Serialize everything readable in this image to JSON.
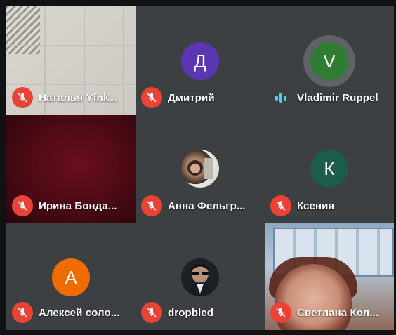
{
  "participants": [
    {
      "name": "Наталья Yfnk...",
      "muted": true,
      "type": "video",
      "background": "ceiling"
    },
    {
      "name": "Дмитрий",
      "muted": true,
      "type": "avatar",
      "initial": "Д",
      "avatar_color": "#5c35b5"
    },
    {
      "name": "Vladimir Ruppel",
      "muted": false,
      "speaking": true,
      "type": "avatar",
      "initial": "V",
      "avatar_color": "#2e7d32"
    },
    {
      "name": "Ирина Бонда...",
      "muted": true,
      "type": "video",
      "background": "maroon"
    },
    {
      "name": "Анна Фельгр...",
      "muted": true,
      "type": "photo",
      "photo": "woman-portrait"
    },
    {
      "name": "Ксения",
      "muted": true,
      "type": "avatar",
      "initial": "К",
      "avatar_color": "#1d5b4a"
    },
    {
      "name": "Алексей соло...",
      "muted": true,
      "type": "avatar",
      "initial": "А",
      "avatar_color": "#ef6c00"
    },
    {
      "name": "dropbled",
      "muted": true,
      "type": "photo",
      "photo": "sunglasses-portrait"
    },
    {
      "name": "Светлана Кол...",
      "muted": true,
      "type": "video",
      "background": "classroom"
    }
  ],
  "colors": {
    "tile_bg": "#3c4043",
    "mic_off": "#ea4335",
    "speaking": "#4dd0e1",
    "app_bg": "#111214"
  },
  "icons": {
    "mic_off": "mic-off-icon",
    "speaking": "audio-level-icon"
  }
}
